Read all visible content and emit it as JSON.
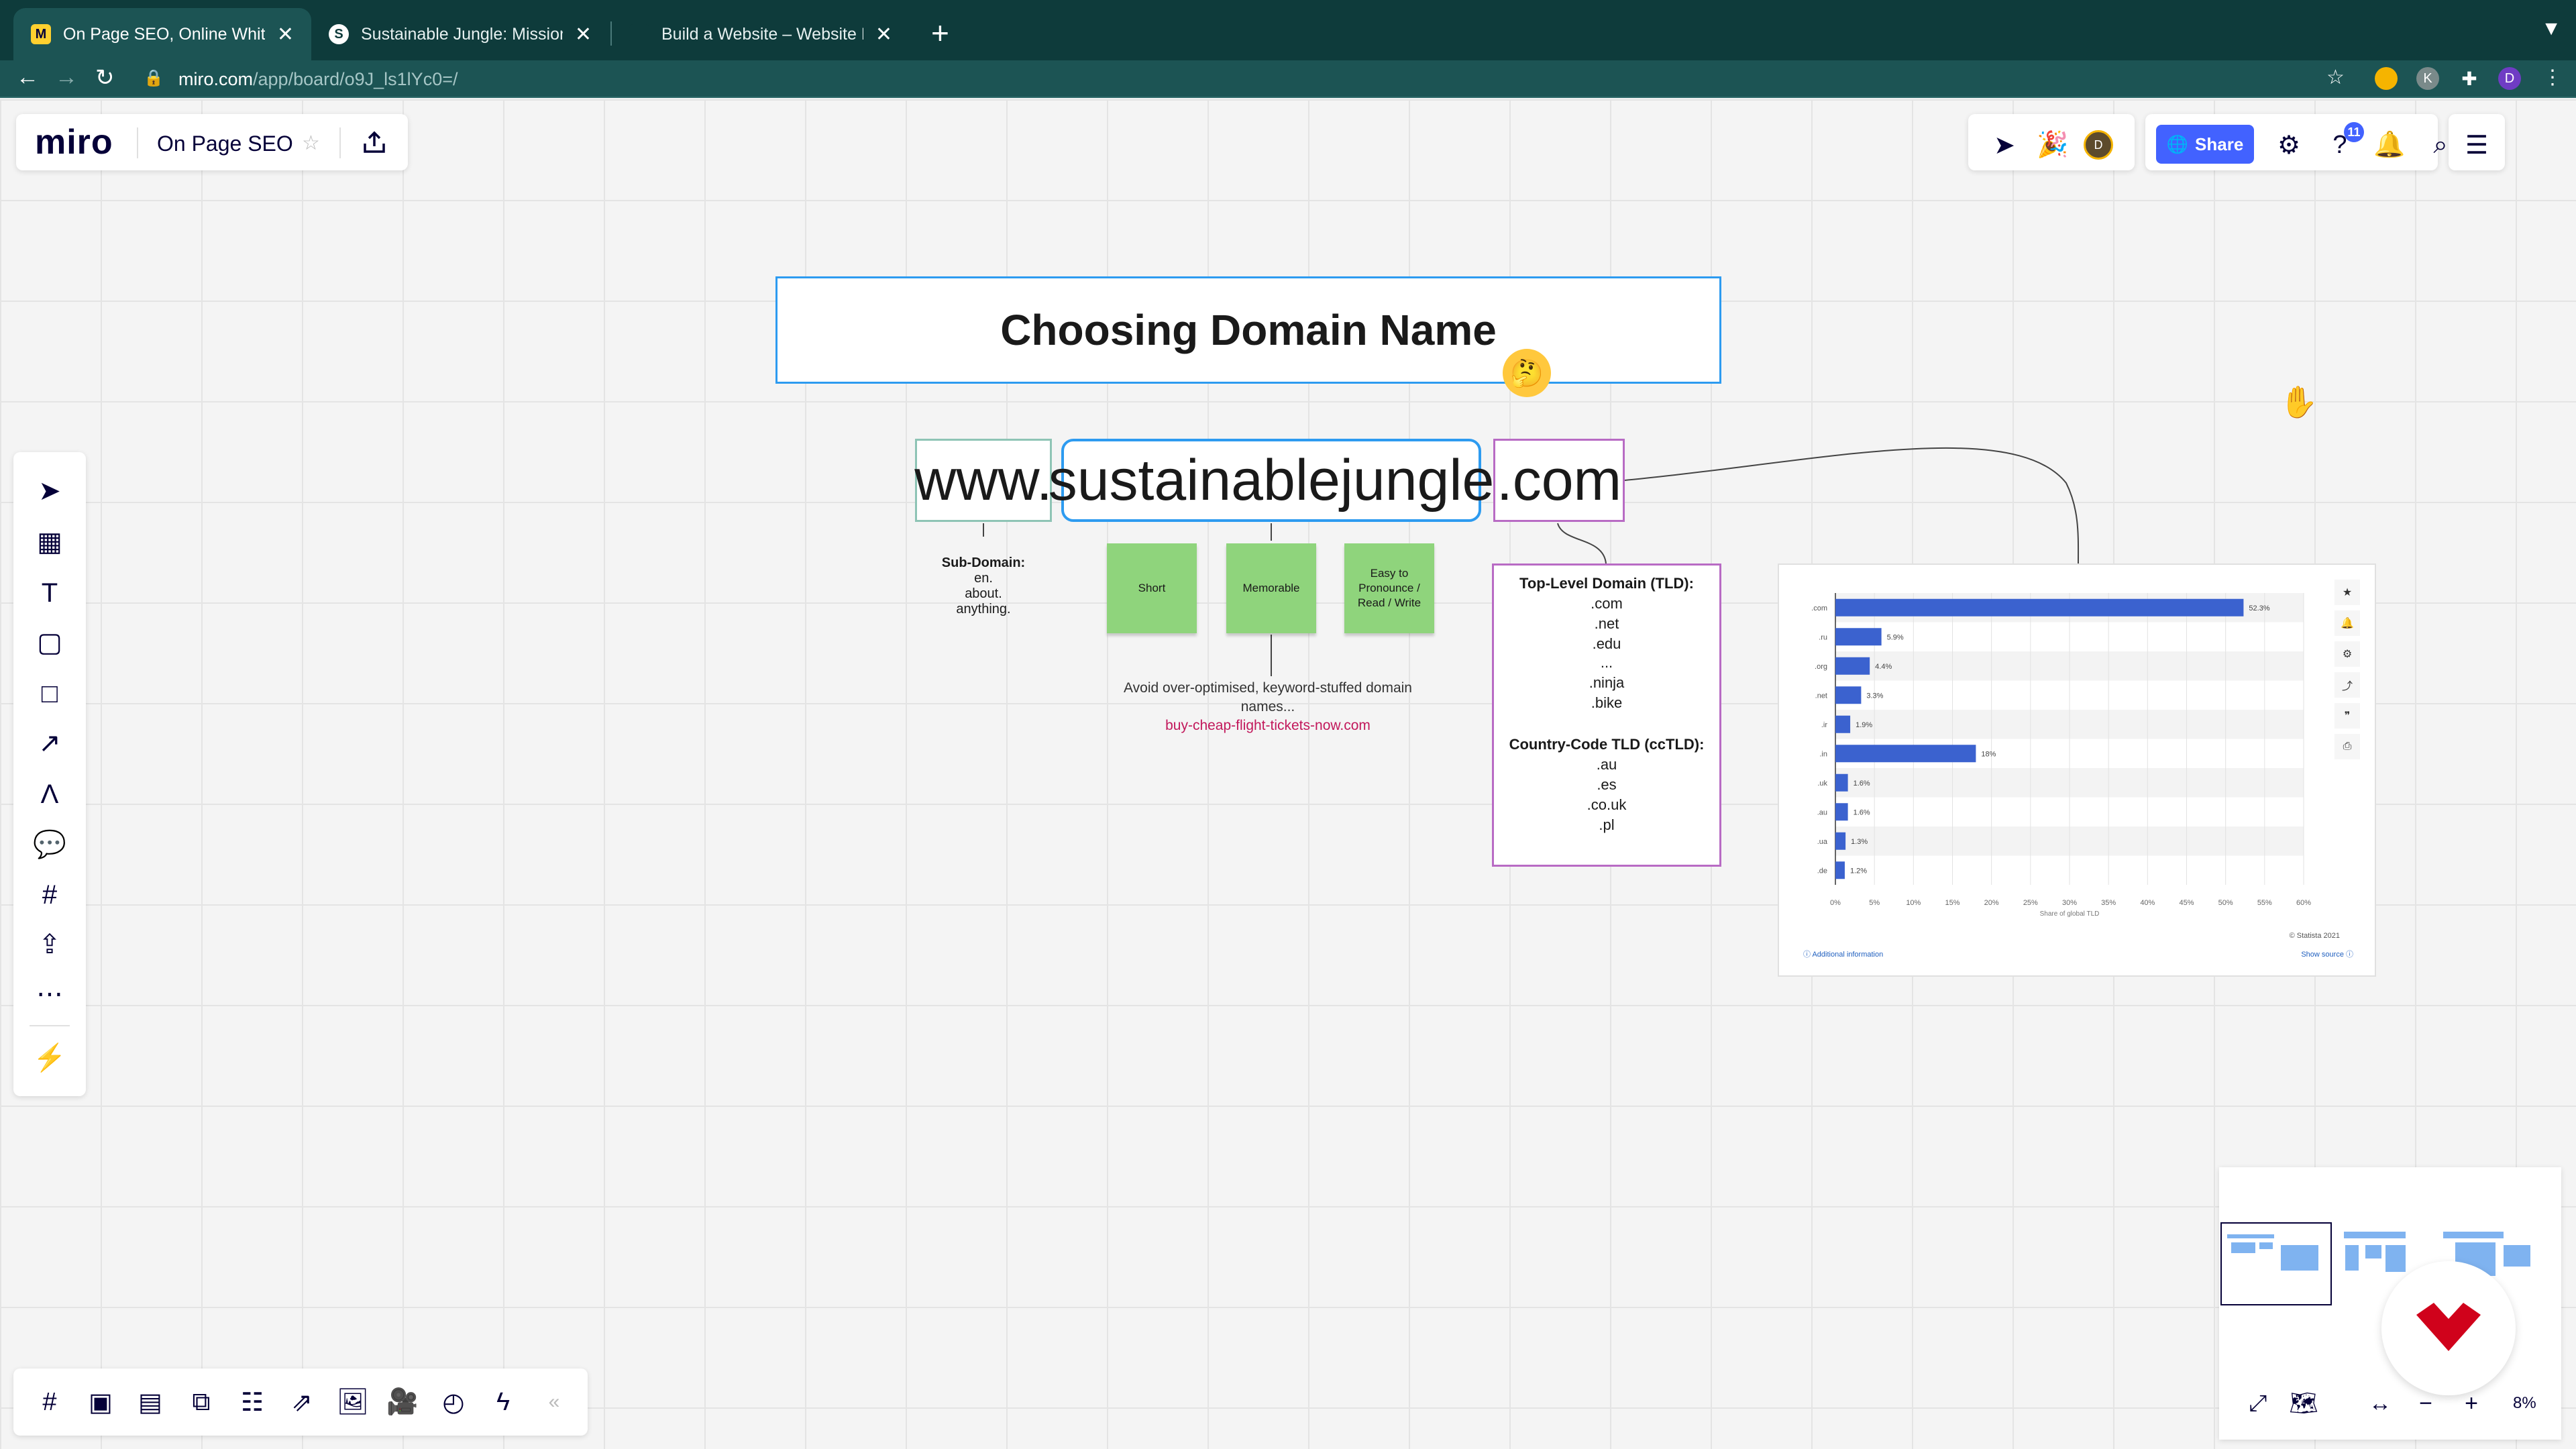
{
  "browser": {
    "tabs": [
      {
        "title": "On Page SEO, Online Whiteboa",
        "active": true,
        "icon": "miro-favicon"
      },
      {
        "title": "Sustainable Jungle: Mission-d",
        "active": false,
        "icon": "sj-favicon"
      },
      {
        "title": "Build a Website – Website Buil",
        "active": false,
        "icon": "builder-favicon"
      }
    ],
    "url_host": "miro.com",
    "url_path": "/app/board/o9J_ls1lYc0=/",
    "profile_initial": "D",
    "ext_initial": "K"
  },
  "miro": {
    "logo": "miro",
    "board_title": "On Page SEO",
    "share_label": "Share",
    "notifications_count": "11",
    "avatar_initial": "D",
    "zoom": "8%",
    "accent_color": "#4262ff"
  },
  "board": {
    "title": "Choosing Domain Name",
    "domain_parts": [
      "www.",
      "sustainablejungle",
      ".com"
    ],
    "subdomain": {
      "heading": "Sub-Domain:",
      "examples": [
        "en.",
        "about.",
        "anything."
      ]
    },
    "stickies": [
      "Short",
      "Memorable",
      "Easy to Pronounce / Read / Write"
    ],
    "avoid_text": "Avoid over-optimised, keyword-stuffed domain names...",
    "avoid_example": "buy-cheap-flight-tickets-now.com",
    "tld": {
      "heading": "Top-Level Domain (TLD):",
      "items": [
        ".com",
        ".net",
        ".edu",
        "...",
        ".ninja",
        ".bike"
      ],
      "cc_heading": "Country-Code TLD (ccTLD):",
      "cc_items": [
        ".au",
        ".es",
        ".co.uk",
        ".pl"
      ]
    }
  },
  "chart_data": {
    "type": "bar",
    "orientation": "horizontal",
    "categories": [
      ".com",
      ".ru",
      ".org",
      ".net",
      ".ir",
      ".in",
      ".uk",
      ".au",
      ".ua",
      ".de"
    ],
    "values": [
      52.3,
      5.9,
      4.4,
      3.3,
      1.9,
      18,
      1.6,
      1.6,
      1.3,
      1.2
    ],
    "value_labels": [
      "52.3%",
      "5.9%",
      "4.4%",
      "3.3%",
      "1.9%",
      "18%",
      "1.6%",
      "1.6%",
      "1.3%",
      "1.2%"
    ],
    "xlabel": "Share of global TLD",
    "xticks": [
      "0%",
      "5%",
      "10%",
      "15%",
      "20%",
      "25%",
      "30%",
      "35%",
      "40%",
      "45%",
      "50%",
      "55%",
      "60%"
    ],
    "xlim": [
      0,
      60
    ],
    "bar_color": "#3b62cf",
    "grid": true,
    "source": "© Statista 2021",
    "additional_info": "Additional information",
    "show_source": "Show source"
  }
}
